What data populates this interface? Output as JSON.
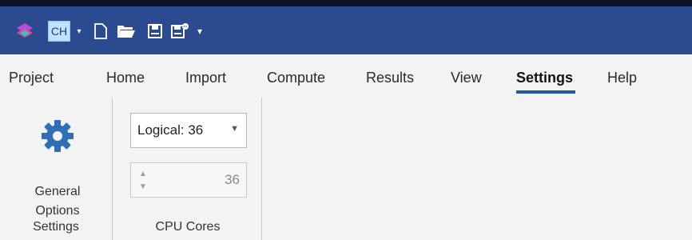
{
  "quick_access": {
    "ch_label": "CH",
    "caret": "▾",
    "more": "▾",
    "icons": [
      "app-logo-icon",
      "new-file-icon",
      "open-folder-icon",
      "save-icon",
      "save-as-icon"
    ]
  },
  "tabs": [
    {
      "label": "Project"
    },
    {
      "label": "Home"
    },
    {
      "label": "Import"
    },
    {
      "label": "Compute"
    },
    {
      "label": "Results"
    },
    {
      "label": "View"
    },
    {
      "label": "Settings",
      "active": true
    },
    {
      "label": "Help"
    }
  ],
  "ribbon": {
    "general_options": {
      "label_line1": "General",
      "label_line2": "Options",
      "icon": "gear-icon"
    },
    "group1_label": "Settings",
    "cpu": {
      "select_value": "Logical: 36",
      "stepper_value": "36",
      "group_label": "CPU Cores"
    }
  },
  "colors": {
    "title_bar": "#2b4a8f",
    "accent": "#1f5a9e",
    "gear": "#2f6fb6"
  }
}
